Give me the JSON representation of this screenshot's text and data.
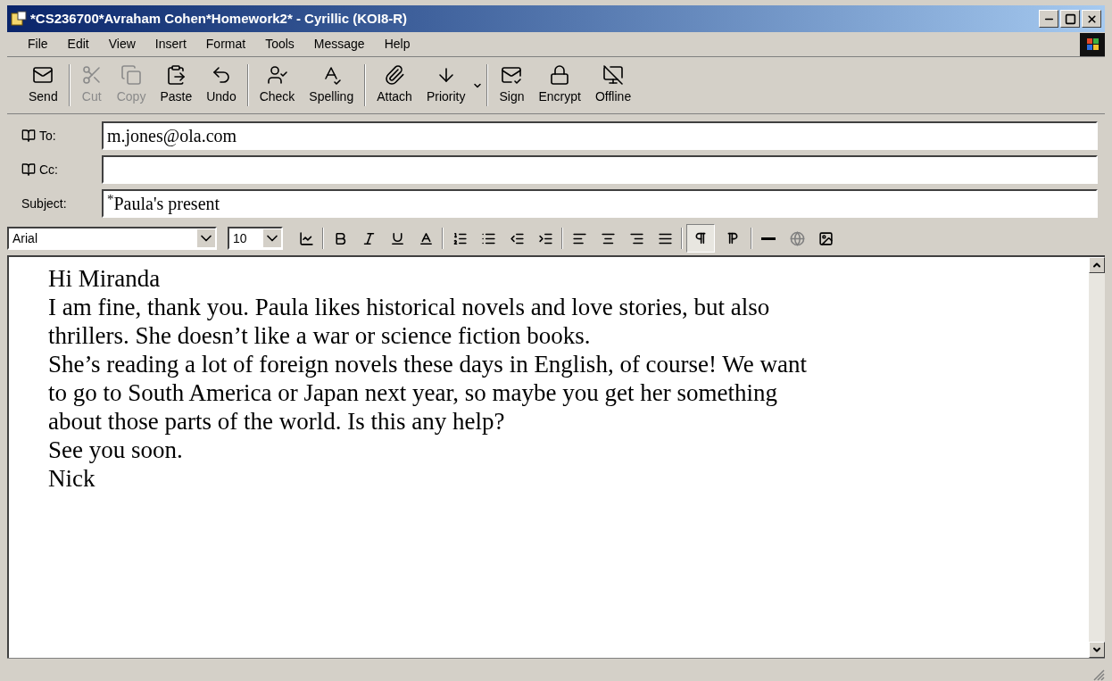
{
  "window": {
    "title": "*CS236700*Avraham Cohen*Homework2* - Cyrillic (KOI8-R)"
  },
  "menu": [
    "File",
    "Edit",
    "View",
    "Insert",
    "Format",
    "Tools",
    "Message",
    "Help"
  ],
  "toolbar": [
    {
      "label": "Send",
      "disabled": false
    },
    {
      "label": "Cut",
      "disabled": true
    },
    {
      "label": "Copy",
      "disabled": true
    },
    {
      "label": "Paste",
      "disabled": false
    },
    {
      "label": "Undo",
      "disabled": false
    },
    {
      "label": "Check",
      "disabled": false
    },
    {
      "label": "Spelling",
      "disabled": false
    },
    {
      "label": "Attach",
      "disabled": false
    },
    {
      "label": "Priority",
      "disabled": false
    },
    {
      "label": "Sign",
      "disabled": false
    },
    {
      "label": "Encrypt",
      "disabled": false
    },
    {
      "label": "Offline",
      "disabled": false
    }
  ],
  "fields": [
    {
      "label": "To:",
      "kind": "address",
      "value": "m.jones@ola.com"
    },
    {
      "label": "Cc:",
      "kind": "address"
    },
    {
      "label": "Subject:",
      "kind": "plain",
      "value": "$^{*}$Paula's present"
    }
  ],
  "format_bar": {
    "font": "Arial",
    "size": "10",
    "direction": [
      {
        "selected": true
      },
      {
        "selected": false
      }
    ]
  },
  "body": {
    "lines": [
      "Hi Miranda",
      "I am fine, thank you. Paula likes historical novels and love stories, but also",
      "thrillers. She doesn’t like a war or science fiction books.",
      "She’s reading a lot of foreign novels these days in English, of course! We want",
      "to go to South America or Japan next year, so maybe you get her something",
      "about those parts of the world. Is this any help?",
      "See you soon.",
      "Nick"
    ]
  }
}
